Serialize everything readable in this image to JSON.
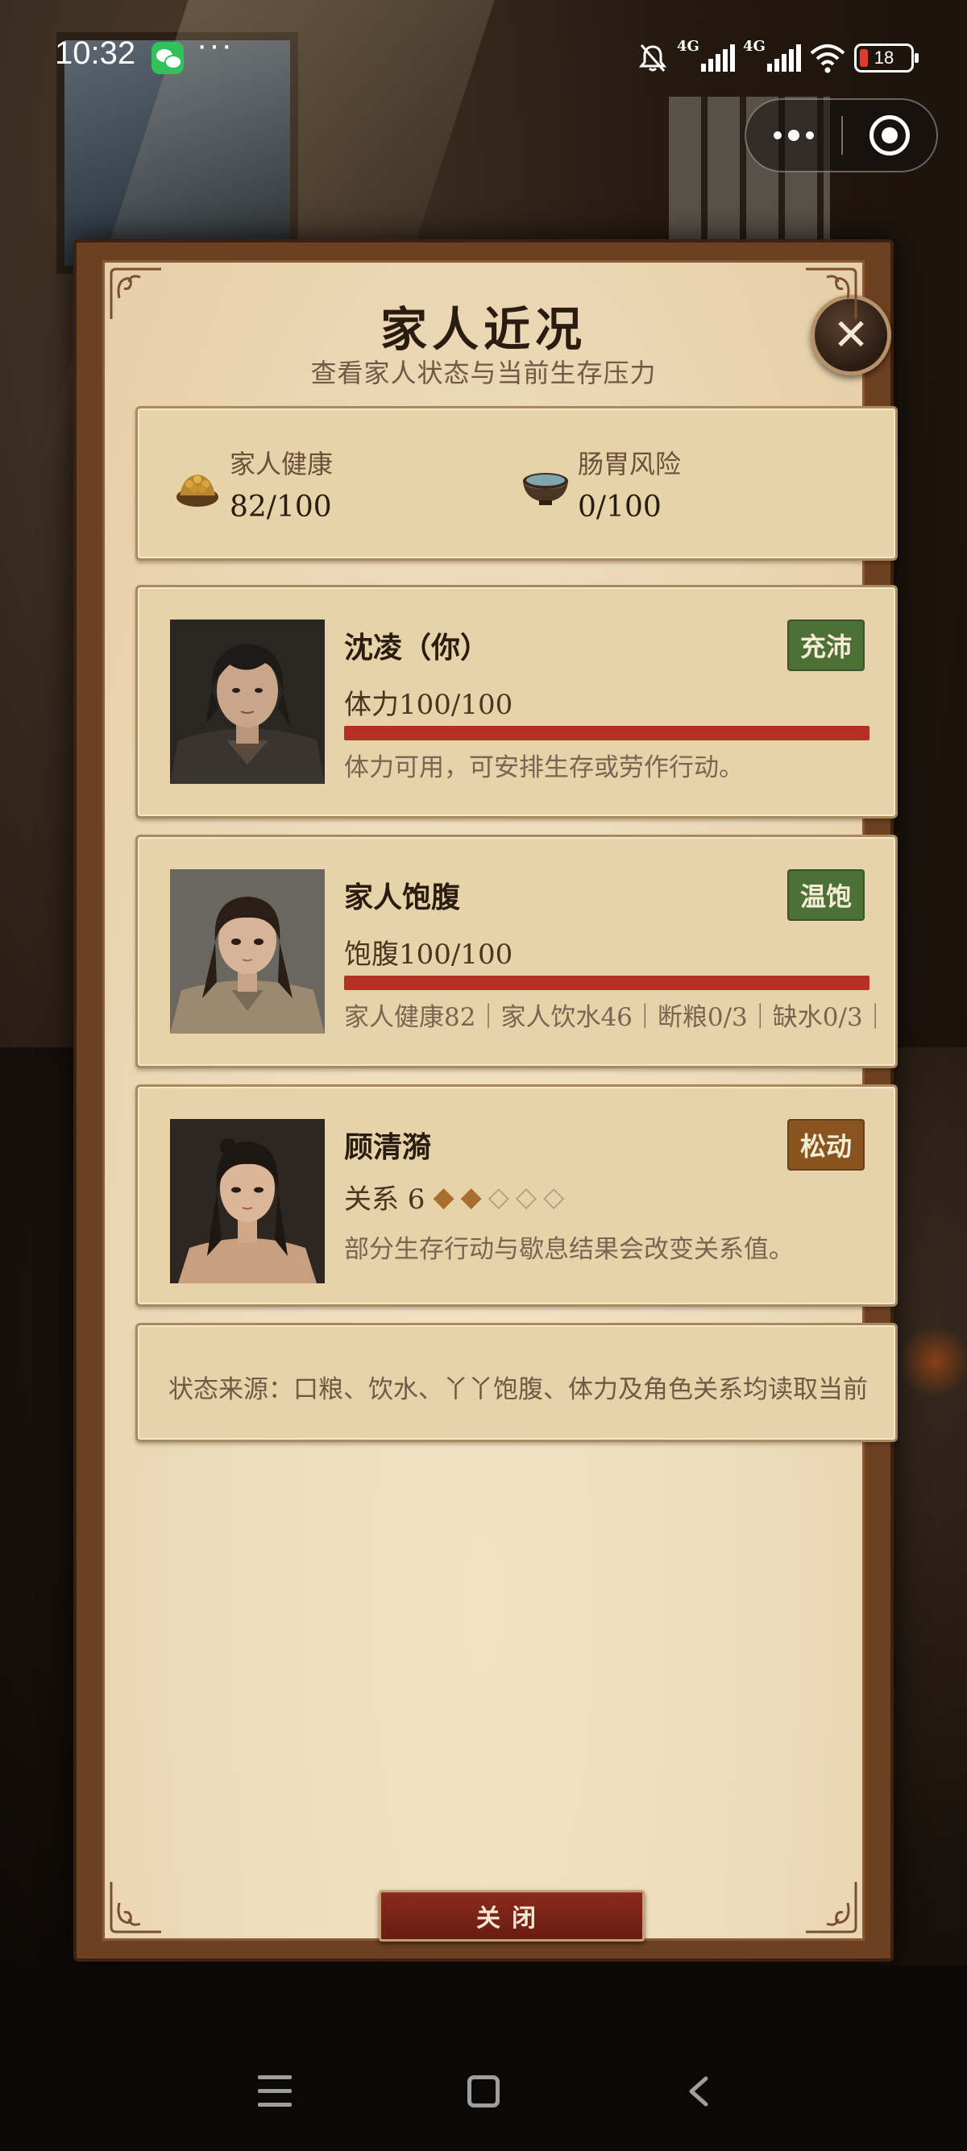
{
  "status_bar": {
    "time": "10:32",
    "more": "···",
    "signal_1_label": "4G",
    "signal_2_label": "4G",
    "battery_level": "18"
  },
  "capsule": {
    "menu_icon": "more-dots-icon",
    "close_icon": "target-close-icon"
  },
  "dialog": {
    "title": "家人近况",
    "subtitle": "查看家人状态与当前生存压力",
    "close_icon": "close-x-icon",
    "stats": [
      {
        "label": "家人健康",
        "value": "82/100",
        "icon": "grain-bag-icon"
      },
      {
        "label": "肠胃风险",
        "value": "0/100",
        "icon": "bowl-icon"
      }
    ],
    "members": [
      {
        "name": "沈凌（你）",
        "badge": "充沛",
        "stat": "体力100/100",
        "progress": 1.0,
        "desc": "体力可用，可安排生存或劳作行动。"
      },
      {
        "name": "家人饱腹",
        "badge": "温饱",
        "stat": "饱腹100/100",
        "progress": 1.0,
        "desc": "家人健康82｜家人饮水46｜断粮0/3｜缺水0/3｜"
      },
      {
        "name": "顾清漪",
        "badge": "松动",
        "stat": "关系 6",
        "relation_filled": 2,
        "relation_total": 5,
        "desc": "部分生存行动与歇息结果会改变关系值。"
      }
    ],
    "source_text": "状态来源：口粮、饮水、丫丫饱腹、体力及角色关系均读取当前",
    "close_button": "关闭"
  },
  "colors": {
    "accent_red": "#b52f24",
    "badge_green": "#4d7036",
    "badge_brown": "#8a5420",
    "parchment": "#e6d3a9"
  }
}
